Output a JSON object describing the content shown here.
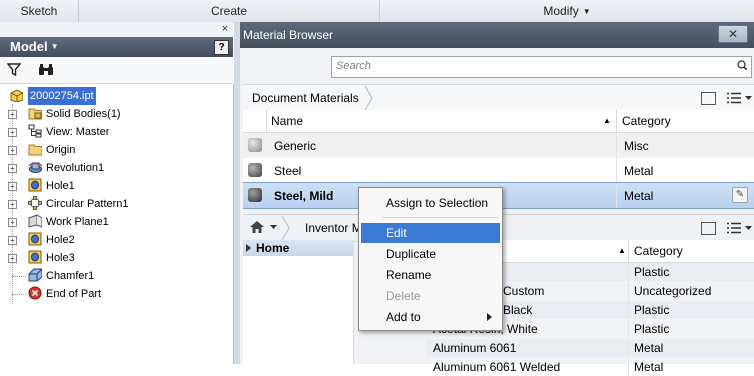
{
  "ribbon": {
    "sketch_label": "Sketch",
    "create_label": "Create",
    "modify_label": "Modify",
    "modify_arrow": "▼"
  },
  "model_panel": {
    "close_glyph": "×",
    "title": "Model",
    "title_arrow": "▼",
    "help_glyph": "?",
    "tree": [
      {
        "label": "20002754.ipt",
        "icon": "part-icon",
        "expander": "",
        "selected": true
      },
      {
        "label": "Solid Bodies(1)",
        "icon": "folder-solid-icon",
        "expander": "+"
      },
      {
        "label": "View: Master",
        "icon": "view-icon",
        "expander": "+"
      },
      {
        "label": "Origin",
        "icon": "folder-icon",
        "expander": "+"
      },
      {
        "label": "Revolution1",
        "icon": "revolve-icon",
        "expander": "+"
      },
      {
        "label": "Hole1",
        "icon": "hole-icon",
        "expander": "+"
      },
      {
        "label": "Circular Pattern1",
        "icon": "circular-pattern-icon",
        "expander": "+"
      },
      {
        "label": "Work Plane1",
        "icon": "work-plane-icon",
        "expander": "+"
      },
      {
        "label": "Hole2",
        "icon": "hole-icon",
        "expander": "+"
      },
      {
        "label": "Hole3",
        "icon": "hole-icon",
        "expander": "+"
      },
      {
        "label": "Chamfer1",
        "icon": "chamfer-icon",
        "expander": ""
      },
      {
        "label": "End of Part",
        "icon": "end-of-part-icon",
        "expander": ""
      }
    ]
  },
  "material_browser": {
    "title": "Material Browser",
    "close_glyph": "✕",
    "search_placeholder": "Search",
    "breadcrumb": "Document Materials",
    "doc_columns": {
      "name": "Name",
      "category": "Category",
      "sort_glyph": "▲"
    },
    "doc_rows": [
      {
        "name": "Generic",
        "category": "Misc",
        "swatch": "#a7a7a7"
      },
      {
        "name": "Steel",
        "category": "Metal",
        "swatch": "#6f6f6f"
      },
      {
        "name": "Steel, Mild",
        "category": "Metal",
        "swatch": "#575757",
        "selected": true
      }
    ],
    "edit_glyph": "✎",
    "library_label": "Inventor M",
    "home_label": "Home",
    "lib_columns": {
      "category": "Category",
      "sort_glyph": "▲"
    },
    "lib_rows": [
      {
        "name": "",
        "category": "Plastic"
      },
      {
        "name": "Custom",
        "category": "Uncategorized"
      },
      {
        "name": "Black",
        "category": "Plastic"
      },
      {
        "name": "Acetal Resin, White",
        "category": "Plastic"
      },
      {
        "name": "Aluminum 6061",
        "category": "Metal"
      },
      {
        "name": "Aluminum 6061 Welded",
        "category": "Metal"
      }
    ]
  },
  "context_menu": {
    "items": [
      {
        "label": "Assign to Selection"
      },
      {
        "label": "Edit",
        "highlighted": true
      },
      {
        "label": "Duplicate"
      },
      {
        "label": "Rename"
      },
      {
        "label": "Delete",
        "disabled": true
      },
      {
        "label": "Add to",
        "submenu": true
      }
    ]
  },
  "colors": {
    "panel_title": "#4b5869",
    "selection": "#3b7bd4",
    "selected_row": "#c3d8f1"
  }
}
